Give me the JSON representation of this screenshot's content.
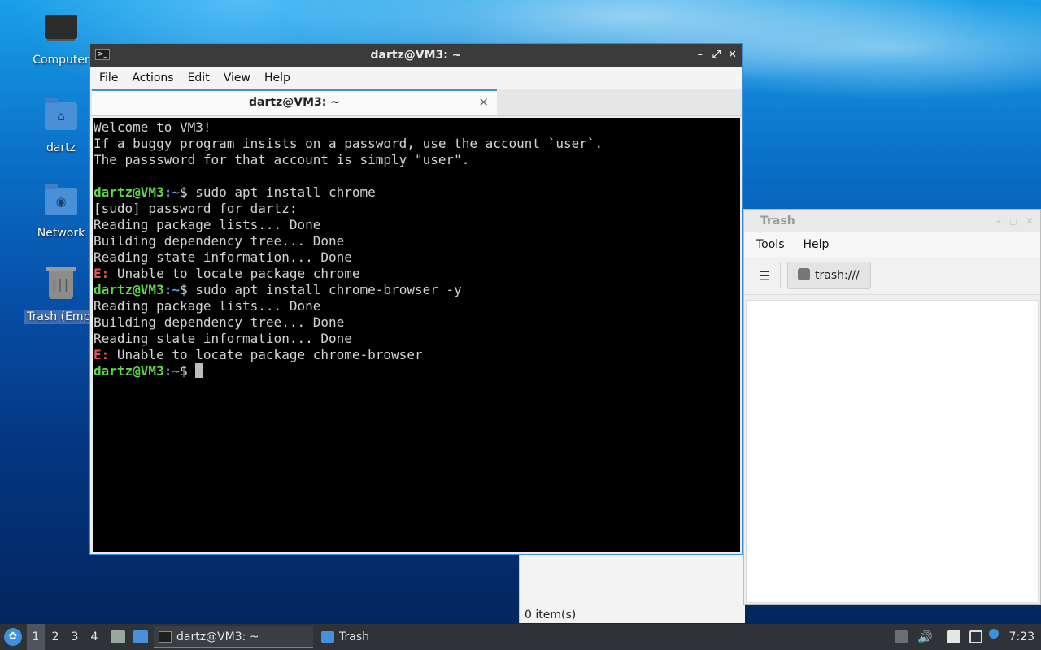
{
  "desktop": {
    "icons": [
      {
        "label": "Computer",
        "icon": "computer-icon"
      },
      {
        "label": "dartz",
        "icon": "home-folder-icon"
      },
      {
        "label": "Network",
        "icon": "network-folder-icon"
      },
      {
        "label": "Trash (Empt",
        "icon": "trash-icon"
      }
    ]
  },
  "terminal": {
    "title": "dartz@VM3: ~",
    "menu": [
      "File",
      "Actions",
      "Edit",
      "View",
      "Help"
    ],
    "tab_label": "dartz@VM3: ~",
    "lines": [
      {
        "t": "Welcome to VM3!"
      },
      {
        "t": "If a buggy program insists on a password, use the account `user`."
      },
      {
        "t": "The passsword for that account is simply \"user\"."
      },
      {
        "t": ""
      },
      {
        "prompt": true,
        "cmd": "sudo apt install chrome"
      },
      {
        "t": "[sudo] password for dartz:"
      },
      {
        "t": "Reading package lists... Done"
      },
      {
        "t": "Building dependency tree... Done"
      },
      {
        "t": "Reading state information... Done"
      },
      {
        "err": true,
        "t": "Unable to locate package chrome"
      },
      {
        "prompt": true,
        "cmd": "sudo apt install chrome-browser -y"
      },
      {
        "t": "Reading package lists... Done"
      },
      {
        "t": "Building dependency tree... Done"
      },
      {
        "t": "Reading state information... Done"
      },
      {
        "err": true,
        "t": "Unable to locate package chrome-browser"
      },
      {
        "prompt": true,
        "cmd": "",
        "cursor": true
      }
    ],
    "prompt_user": "dartz@VM3",
    "prompt_path": "~",
    "prompt_sigil": "$",
    "error_prefix": "E:"
  },
  "trash_window": {
    "title": "Trash",
    "menu": [
      "Tools",
      "Help"
    ],
    "path": "trash:///",
    "status": "0 item(s)"
  },
  "taskbar": {
    "workspaces": [
      "1",
      "2",
      "3",
      "4"
    ],
    "active_workspace": "1",
    "tasks": [
      {
        "label": "dartz@VM3: ~",
        "icon": "terminal-icon",
        "active": true
      },
      {
        "label": "Trash",
        "icon": "folder-icon",
        "active": false
      }
    ],
    "clock": "7:23"
  },
  "colors": {
    "accent": "#3b8fd4",
    "prompt_green": "#5fd84a",
    "prompt_blue": "#6a9ad8",
    "error_red": "#e05555"
  }
}
